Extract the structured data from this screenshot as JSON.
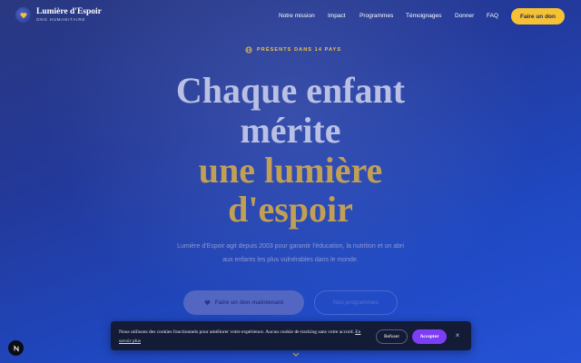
{
  "brand": {
    "name": "Lumière d'Espoir",
    "tagline": "ONG HUMANITAIRE"
  },
  "nav": {
    "items": [
      {
        "label": "Notre mission"
      },
      {
        "label": "Impact"
      },
      {
        "label": "Programmes"
      },
      {
        "label": "Témoignages"
      },
      {
        "label": "Donner"
      },
      {
        "label": "FAQ"
      }
    ],
    "cta_label": "Faire un don"
  },
  "hero": {
    "badge": "PRÉSENTS DANS 14 PAYS",
    "headline": {
      "line1": "Chaque enfant",
      "line2": "mérite",
      "line3": "une lumière",
      "line4": "d'espoir"
    },
    "description": "Lumière d'Espoir agit depuis 2003 pour garantir l'éducation, la nutrition et un abri aux enfants les plus vulnérables dans le monde.",
    "primary_cta": "Faire un don maintenant",
    "secondary_cta": "Nos programmes"
  },
  "cookie_banner": {
    "text": "Nous utilisons des cookies fonctionnels pour améliorer votre expérience. Aucun cookie de tracking sans votre accord.",
    "link_label": "En savoir plus",
    "refuse_label": "Refuser",
    "accept_label": "Accepter",
    "close_label": "×"
  },
  "colors": {
    "accent_gold": "#f6c233",
    "accept_purple": "#7d3df5",
    "banner_bg": "#131b36"
  },
  "icons": {
    "logo": "heart-icon",
    "badge": "globe-icon",
    "cta": "heart-icon",
    "scroll": "chevron-down-icon",
    "dev_badge": "n-logo-icon"
  }
}
